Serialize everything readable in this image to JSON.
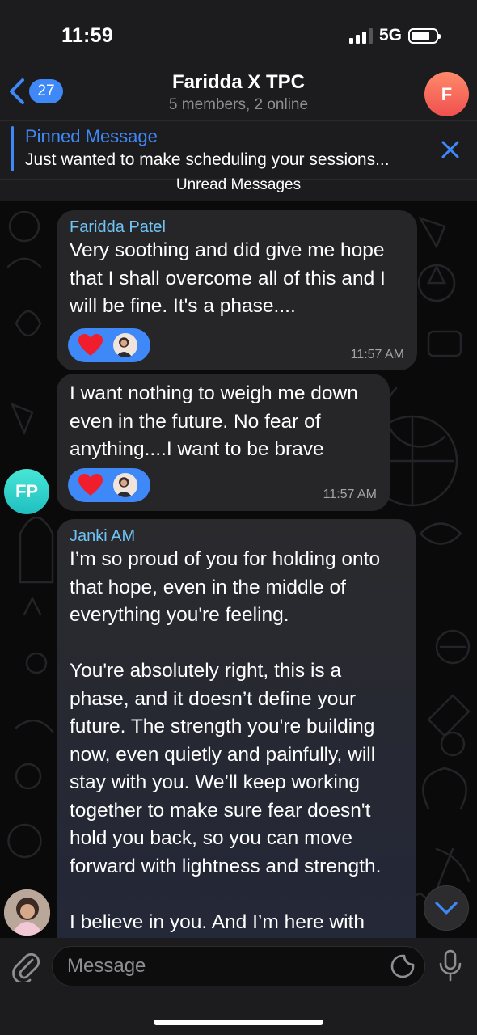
{
  "status_bar": {
    "time": "11:59",
    "network": "5G"
  },
  "header": {
    "back_count": "27",
    "title": "Faridda X TPC",
    "subtitle": "5 members, 2 online",
    "avatar_initial": "F"
  },
  "pinned": {
    "title": "Pinned Message",
    "text": "Just wanted to make scheduling your sessions..."
  },
  "unread_banner": "Unread Messages",
  "messages": [
    {
      "sender": "Faridda Patel",
      "text": "Very soothing and did give me hope\nthat I shall overcome all of this and I\nwill be fine. It's a phase....",
      "time": "11:57 AM",
      "reaction": "heart"
    },
    {
      "sender": "",
      "text": "I want nothing to weigh me down\neven in the future. No fear of\nanything....I want to be brave",
      "time": "11:57 AM",
      "reaction": "heart"
    },
    {
      "sender": "Janki AM",
      "text": "I’m so proud of you for holding onto\nthat hope, even in the middle of\neverything you're feeling.\n\nYou're absolutely right, this is a\nphase, and it doesn’t define your\nfuture. The strength you're building\nnow, even quietly and painfully, will\nstay with you. We’ll keep working\ntogether to make sure fear doesn't\nhold you back, so you can move\nforward with lightness and strength.\n\nI believe in you. And I’m here with"
    }
  ],
  "sender_avatar_initials": "FP",
  "input": {
    "placeholder": "Message"
  },
  "colors": {
    "accent": "#3e88f7",
    "sender_name": "#6fc3f5",
    "bubble": "#262628",
    "header_bg": "#1c1c1e"
  }
}
